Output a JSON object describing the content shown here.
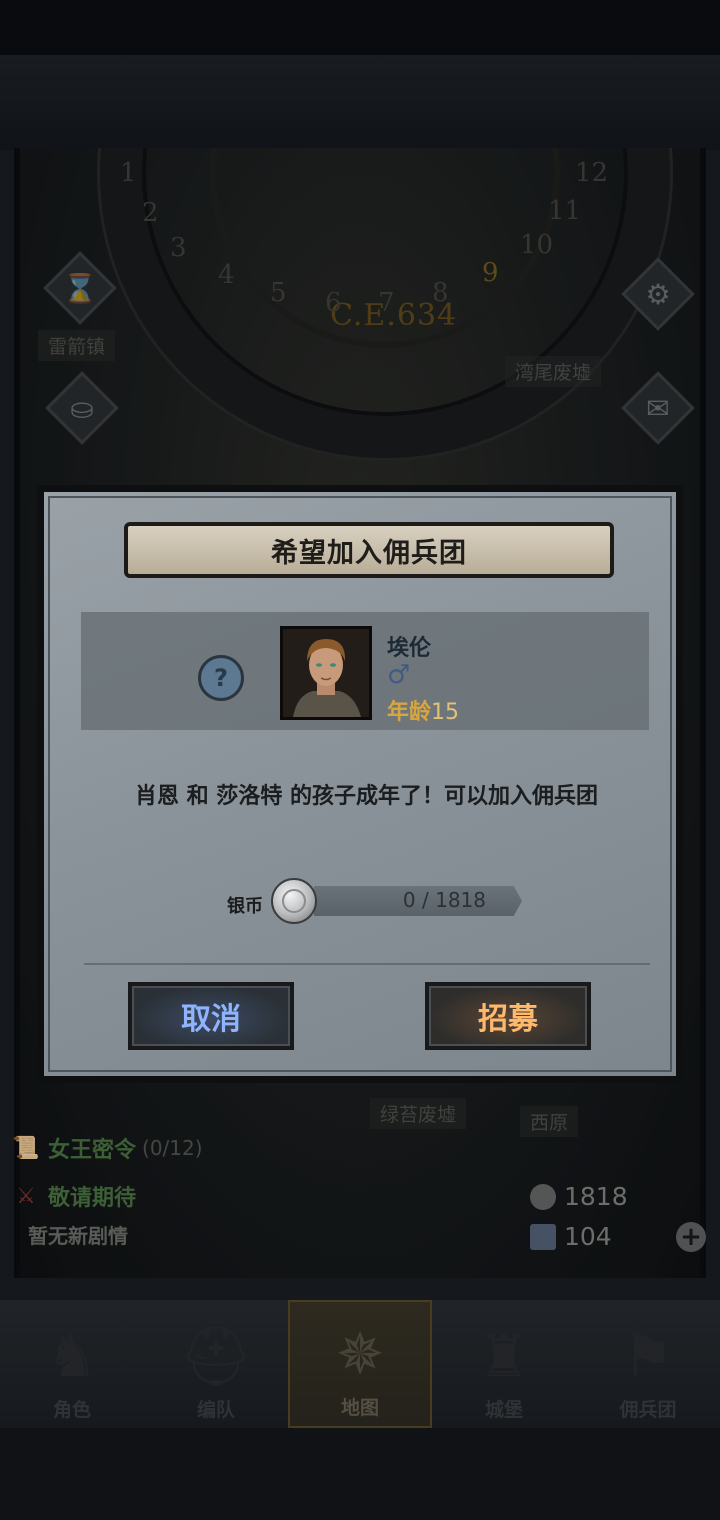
{
  "map": {
    "era": "C.E.634",
    "dial_numbers": [
      "1",
      "2",
      "3",
      "4",
      "5",
      "6",
      "7",
      "8",
      "9",
      "10",
      "11",
      "12"
    ],
    "locations": [
      "雷箭镇",
      "湾尾废墟",
      "绿苔废墟",
      "西原"
    ]
  },
  "dialog": {
    "title": "希望加入佣兵团",
    "character": {
      "name": "埃伦",
      "gender_symbol": "♂",
      "age_label": "年龄",
      "age_value": "15"
    },
    "message": "肖恩 和 莎洛特 的孩子成年了！可以加入佣兵团",
    "cost": {
      "label": "银币",
      "current": 0,
      "required": 1818,
      "display": "0 / 1818"
    },
    "buttons": {
      "cancel": "取消",
      "recruit": "招募"
    }
  },
  "quests": {
    "queen_order": {
      "title": "女王密令",
      "count": "(0/12)"
    },
    "coming_soon": {
      "title": "敬请期待"
    },
    "no_story": "暂无新剧情"
  },
  "resources": {
    "silver": "1818",
    "crystal": "104"
  },
  "nav": [
    {
      "label": "角色",
      "icon": "knight-icon"
    },
    {
      "label": "编队",
      "icon": "helmet-icon"
    },
    {
      "label": "地图",
      "icon": "compass-icon"
    },
    {
      "label": "城堡",
      "icon": "castle-icon"
    },
    {
      "label": "佣兵团",
      "icon": "banner-icon"
    }
  ],
  "colors": {
    "accent_gold": "#d7a63f",
    "cancel_text": "#8fb3ff",
    "recruit_text": "#ffb96b",
    "quest_green": "#4d7a45"
  }
}
